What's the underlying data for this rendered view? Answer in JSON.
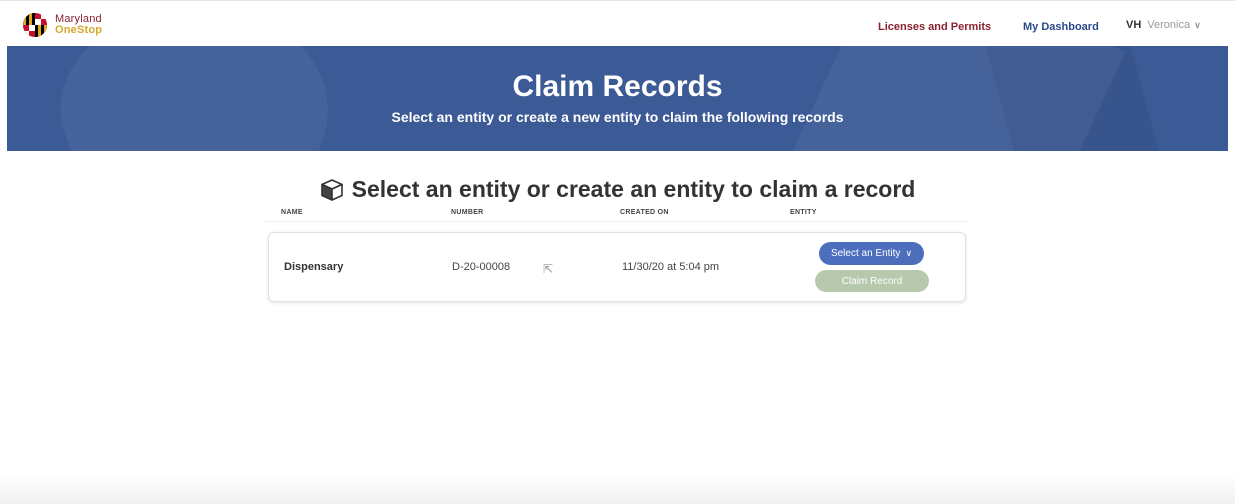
{
  "header": {
    "logo_line1": "Maryland",
    "logo_line2": "OneStop",
    "nav_licenses": "Licenses and Permits",
    "nav_dashboard": "My Dashboard",
    "user_initials": "VH",
    "user_name": "Veronica"
  },
  "banner": {
    "title": "Claim Records",
    "subtitle": "Select an entity or create a new entity to claim the following records"
  },
  "section": {
    "title": "Select an entity or create an entity to claim a record"
  },
  "table": {
    "headers": [
      "NAME",
      "NUMBER",
      "CREATED ON",
      "ENTITY"
    ],
    "rows": [
      {
        "name": "Dispensary",
        "number": "D-20-00008",
        "created_on": "11/30/20 at 5:04 pm",
        "select_label": "Select an Entity",
        "claim_label": "Claim Record"
      }
    ]
  },
  "colors": {
    "brand_red": "#8a2230",
    "brand_gold": "#d7a72b",
    "banner_blue": "#3c5a96",
    "button_blue": "#4d6dbd",
    "button_disabled_green": "#b7c9ad"
  }
}
